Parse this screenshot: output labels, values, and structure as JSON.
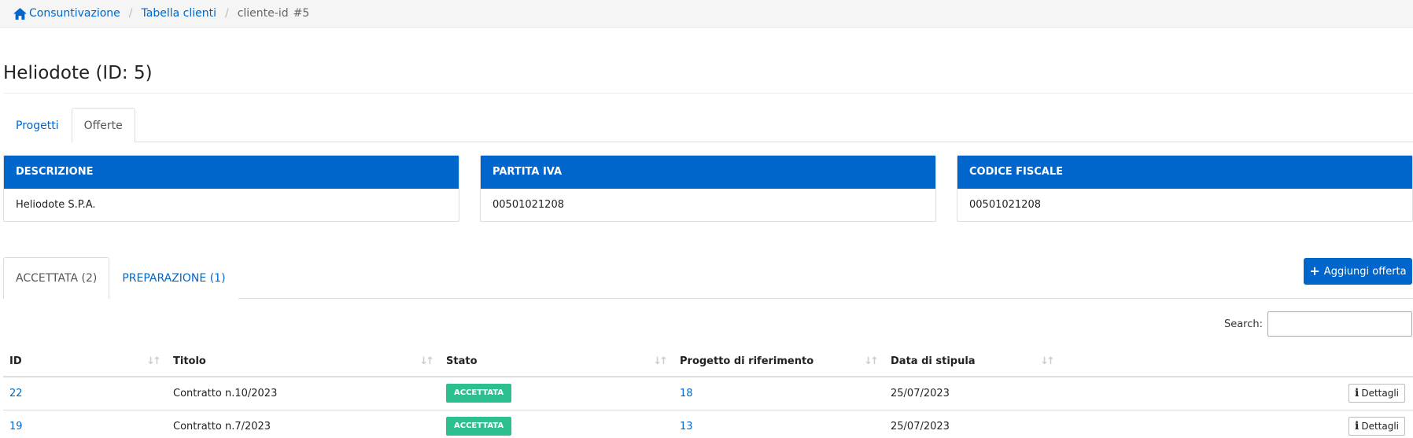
{
  "breadcrumb": {
    "home_icon": "home-icon",
    "items": [
      "Consuntivazione",
      "Tabella clienti"
    ],
    "current": "cliente-id",
    "current_suffix": "#5",
    "separator": "/"
  },
  "page": {
    "title": "Heliodote (ID: 5)"
  },
  "main_tabs": [
    {
      "label": "Progetti",
      "active": false
    },
    {
      "label": "Offerte",
      "active": true
    }
  ],
  "cards": [
    {
      "header": "DESCRIZIONE",
      "value": "Heliodote S.P.A."
    },
    {
      "header": "PARTITA IVA",
      "value": "00501021208"
    },
    {
      "header": "CODICE FISCALE",
      "value": "00501021208"
    }
  ],
  "sub_tabs": [
    {
      "label": "ACCETTATA (2)",
      "active": true
    },
    {
      "label": "PREPARAZIONE (1)",
      "active": false
    }
  ],
  "add_button": {
    "icon": "plus-icon",
    "label": "Aggiungi offerta"
  },
  "search": {
    "label": "Search:",
    "value": "",
    "placeholder": ""
  },
  "table": {
    "columns": [
      "ID",
      "Titolo",
      "Stato",
      "Progetto di riferimento",
      "Data di stipula",
      ""
    ],
    "rows": [
      {
        "id": "22",
        "titolo": "Contratto n.10/2023",
        "stato": "ACCETTATA",
        "progetto": "18",
        "data": "25/07/2023",
        "action": "Dettagli"
      },
      {
        "id": "19",
        "titolo": "Contratto n.7/2023",
        "stato": "ACCETTATA",
        "progetto": "13",
        "data": "25/07/2023",
        "action": "Dettagli"
      }
    ]
  },
  "colors": {
    "primary": "#0066cc",
    "badge_success": "#2dbf8f",
    "breadcrumb_bg": "#f5f5f5"
  }
}
